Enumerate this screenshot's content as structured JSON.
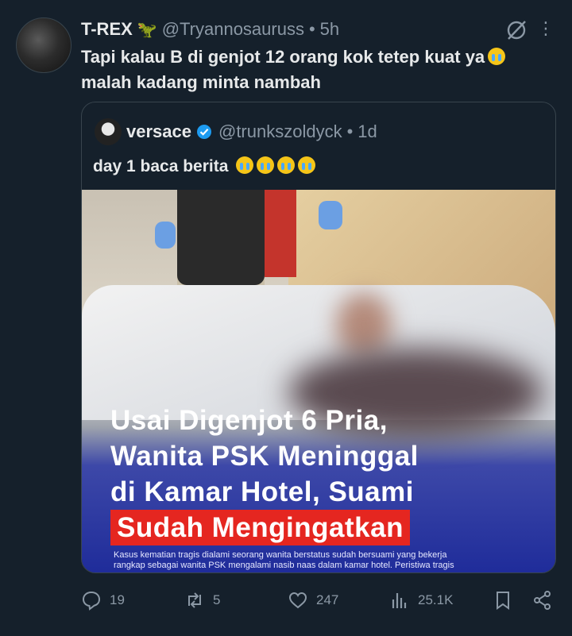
{
  "author": {
    "name": "T-REX",
    "emoji": "🦖",
    "handle": "@Tryannosauruss",
    "separator": "•",
    "time": "5h"
  },
  "tweet": {
    "line1": "Tapi kalau B di genjot 12 orang kok tetep kuat ya",
    "line2": "malah kadang minta nambah"
  },
  "quote": {
    "name": "versace",
    "handle": "@trunkszoldyck",
    "separator": "•",
    "time": "1d",
    "text": "day 1 baca berita",
    "image": {
      "headline1": "Usai Digenjot 6 Pria,",
      "headline2": "Wanita PSK Meninggal",
      "headline3": "di Kamar Hotel, Suami",
      "headline4": "Sudah Mengingatkan",
      "sub1": "Kasus kematian tragis dialami seorang wanita berstatus sudah bersuami yang bekerja",
      "sub2": "rangkap sebagai wanita PSK mengalami nasib naas dalam kamar hotel. Peristiwa tragis"
    }
  },
  "actions": {
    "replies": "19",
    "reposts": "5",
    "likes": "247",
    "views": "25.1K"
  },
  "colors": {
    "background": "#15202b",
    "text": "#e7e9ea",
    "muted": "#8b98a5",
    "accent": "#1d9bf0",
    "border": "#38444d"
  }
}
